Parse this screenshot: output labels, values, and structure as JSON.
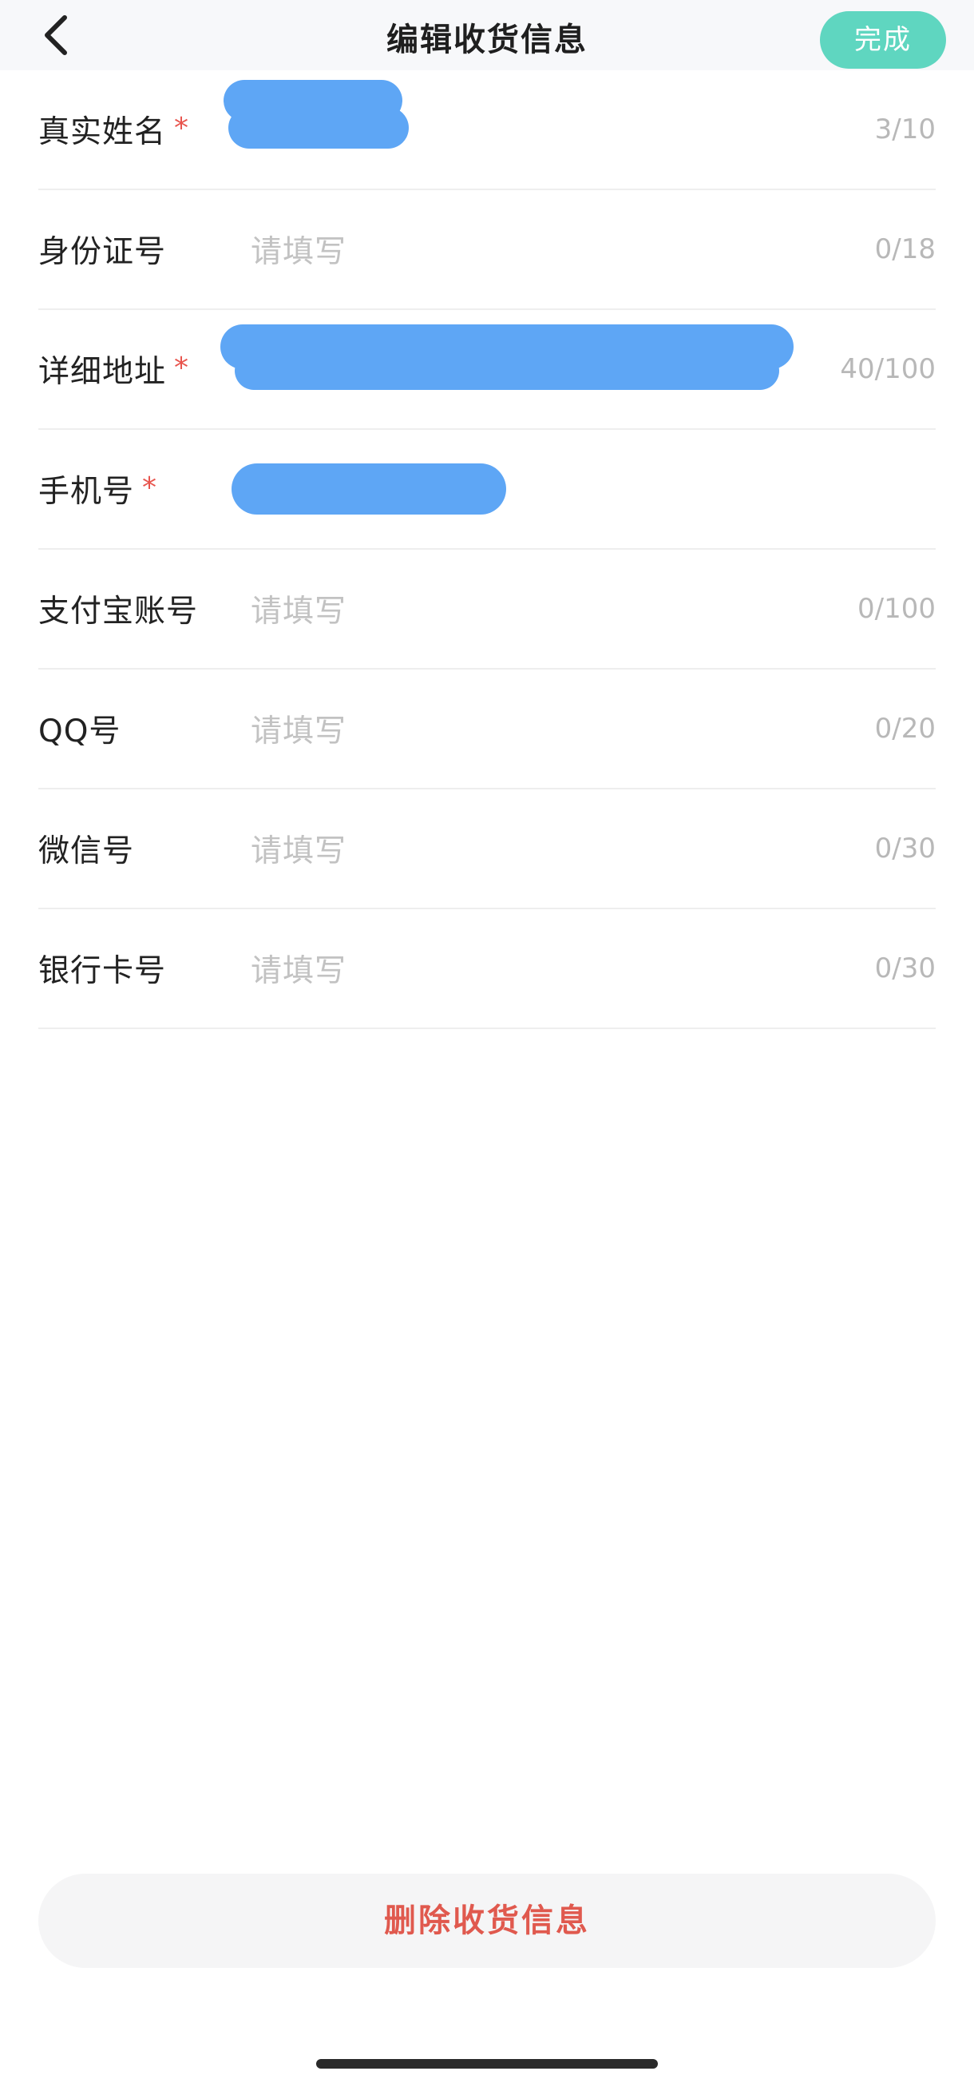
{
  "header": {
    "title": "编辑收货信息",
    "done_label": "完成"
  },
  "fields": [
    {
      "label": "真实姓名",
      "required": "*",
      "value": "",
      "placeholder": "",
      "counter": "3/10",
      "redacted": true
    },
    {
      "label": "身份证号",
      "required": "",
      "value": "",
      "placeholder": "请填写",
      "counter": "0/18",
      "redacted": false
    },
    {
      "label": "详细地址",
      "required": "*",
      "value": "",
      "placeholder": "",
      "counter": "40/100",
      "redacted": true
    },
    {
      "label": "手机号",
      "required": "*",
      "value": "",
      "placeholder": "",
      "counter": "",
      "redacted": true
    },
    {
      "label": "支付宝账号",
      "required": "",
      "value": "",
      "placeholder": "请填写",
      "counter": "0/100",
      "redacted": false
    },
    {
      "label": "QQ号",
      "required": "",
      "value": "",
      "placeholder": "请填写",
      "counter": "0/20",
      "redacted": false
    },
    {
      "label": "微信号",
      "required": "",
      "value": "",
      "placeholder": "请填写",
      "counter": "0/30",
      "redacted": false
    },
    {
      "label": "银行卡号",
      "required": "",
      "value": "",
      "placeholder": "请填写",
      "counter": "0/30",
      "redacted": false
    }
  ],
  "delete_label": "删除收货信息",
  "colors": {
    "accent": "#5fd6c0",
    "required_mark": "#e8554e",
    "delete_text": "#e0594e",
    "redaction": "#5ea6f5"
  },
  "icons": {
    "back": "chevron-left-icon"
  }
}
